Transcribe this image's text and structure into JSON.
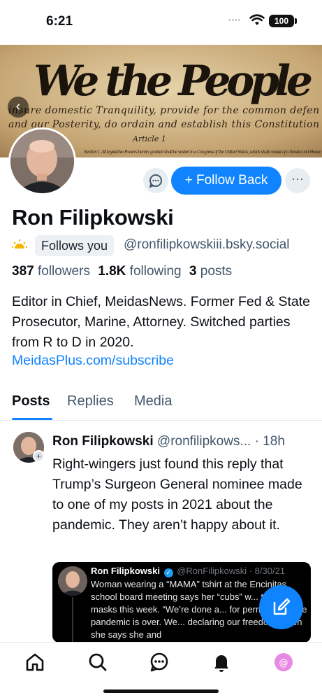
{
  "status_bar": {
    "time": "6:21",
    "signal": "••••",
    "battery": "100"
  },
  "banner": {
    "headline": "We the People",
    "line1": "insure domestic Tranquility, provide for the common defen",
    "line2": "and our Posterity, do ordain and establish this Constitution",
    "line3": "Article 1",
    "line4": "Section 1. All legislative Powers herein granted shall be vested in a Congress of the United States, which shall consist of a Senate and House"
  },
  "header": {
    "back_icon": "chevron-left-icon"
  },
  "profile": {
    "name": "Ron Filipkowski",
    "follows_you": "Follows you",
    "handle": "@ronfilipkowskiii.bsky.social",
    "stats": {
      "followers_count": "387",
      "followers_label": "followers",
      "following_count": "1.8K",
      "following_label": "following",
      "posts_count": "3",
      "posts_label": "posts"
    },
    "bio": "Editor in Chief, MeidasNews. Former Fed & State Prosecutor, Marine, Attorney. Switched parties from R to D in 2020.",
    "link": "MeidasPlus.com/subscribe"
  },
  "actions": {
    "follow_back": "+ Follow Back",
    "more": "···"
  },
  "tabs": [
    {
      "label": "Posts",
      "active": true
    },
    {
      "label": "Replies",
      "active": false
    },
    {
      "label": "Media",
      "active": false
    }
  ],
  "post": {
    "author": "Ron Filipkowski",
    "handle": "@ronfilipkows...",
    "time": "· 18h",
    "text": "Right-wingers just found this reply that Trump’s Surgeon General nominee made to one of my posts in 2021 about the pandemic. They aren’t happy about it.",
    "embed": {
      "author": "Ron Filipkowski",
      "handle": "@RonFilipkowski · 8/30/21",
      "text": "Woman wearing a “MAMA” tshirt at the Encinitas school board meeting says her “cubs” w... to wear masks this week. “We’re done a... for permission. The pandemic is over. We... declaring our freedom.”Then she says she and"
    }
  },
  "colors": {
    "accent": "#1083fe",
    "muted": "#42576c",
    "notif_avatar": "#e889e3"
  },
  "bottom_nav": [
    "home-icon",
    "search-icon",
    "chat-icon",
    "bell-icon",
    "profile-avatar"
  ]
}
